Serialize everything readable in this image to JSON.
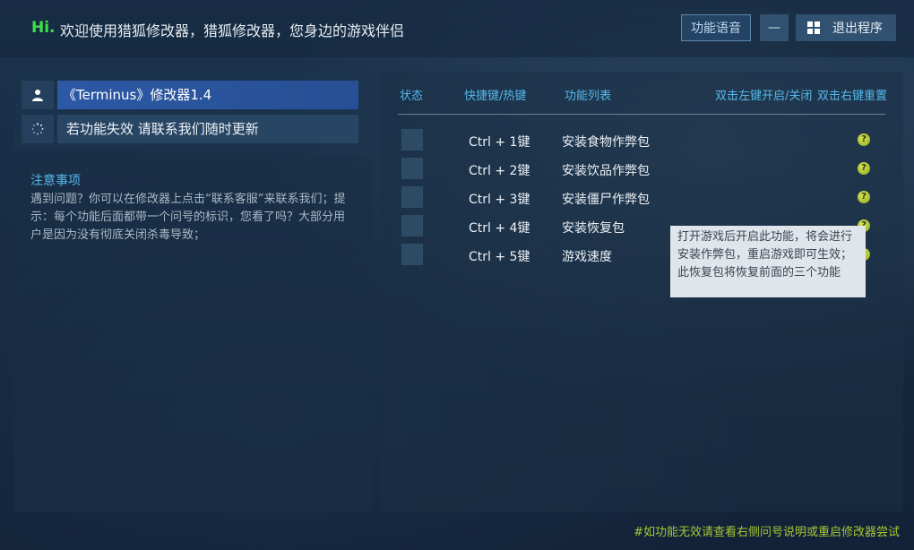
{
  "header": {
    "hi": "Hi.",
    "welcome": "欢迎使用猎狐修改器，猎狐修改器，您身边的游戏伴侣",
    "voice_button": "功能语音",
    "minimize_symbol": "—",
    "exit_button": "退出程序"
  },
  "left": {
    "game_title": "《Terminus》修改器1.4",
    "notice": "若功能失效 请联系我们随时更新",
    "notes_title": "注意事项",
    "notes_body": "遇到问题？你可以在修改器上点击“联系客服”来联系我们；提示：每个功能后面都带一个问号的标识，您看了吗？大部分用户是因为没有彻底关闭杀毒导致；"
  },
  "table": {
    "headers": {
      "status": "状态",
      "hotkey": "快捷键/热键",
      "functions": "功能列表",
      "left_click": "双击左键开启/关闭",
      "right_click": "双击右键重置"
    },
    "rows": [
      {
        "hotkey": "Ctrl + 1键",
        "func": "安装食物作弊包"
      },
      {
        "hotkey": "Ctrl + 2键",
        "func": "安装饮品作弊包"
      },
      {
        "hotkey": "Ctrl + 3键",
        "func": "安装僵尸作弊包"
      },
      {
        "hotkey": "Ctrl + 4键",
        "func": "安装恢复包"
      },
      {
        "hotkey": "Ctrl + 5键",
        "func": "游戏速度"
      }
    ],
    "help_symbol": "?"
  },
  "tooltip": "打开游戏后开启此功能，将会进行安装作弊包，重启游戏即可生效；此恢复包将恢复前面的三个功能",
  "footer": "#如功能无效请查看右侧问号说明或重启修改器尝试",
  "colors": {
    "accent_blue": "#56b8ea",
    "hi_green": "#3ee04a",
    "footer_green": "#a6c832",
    "selected_bar": "#2c58a4"
  }
}
